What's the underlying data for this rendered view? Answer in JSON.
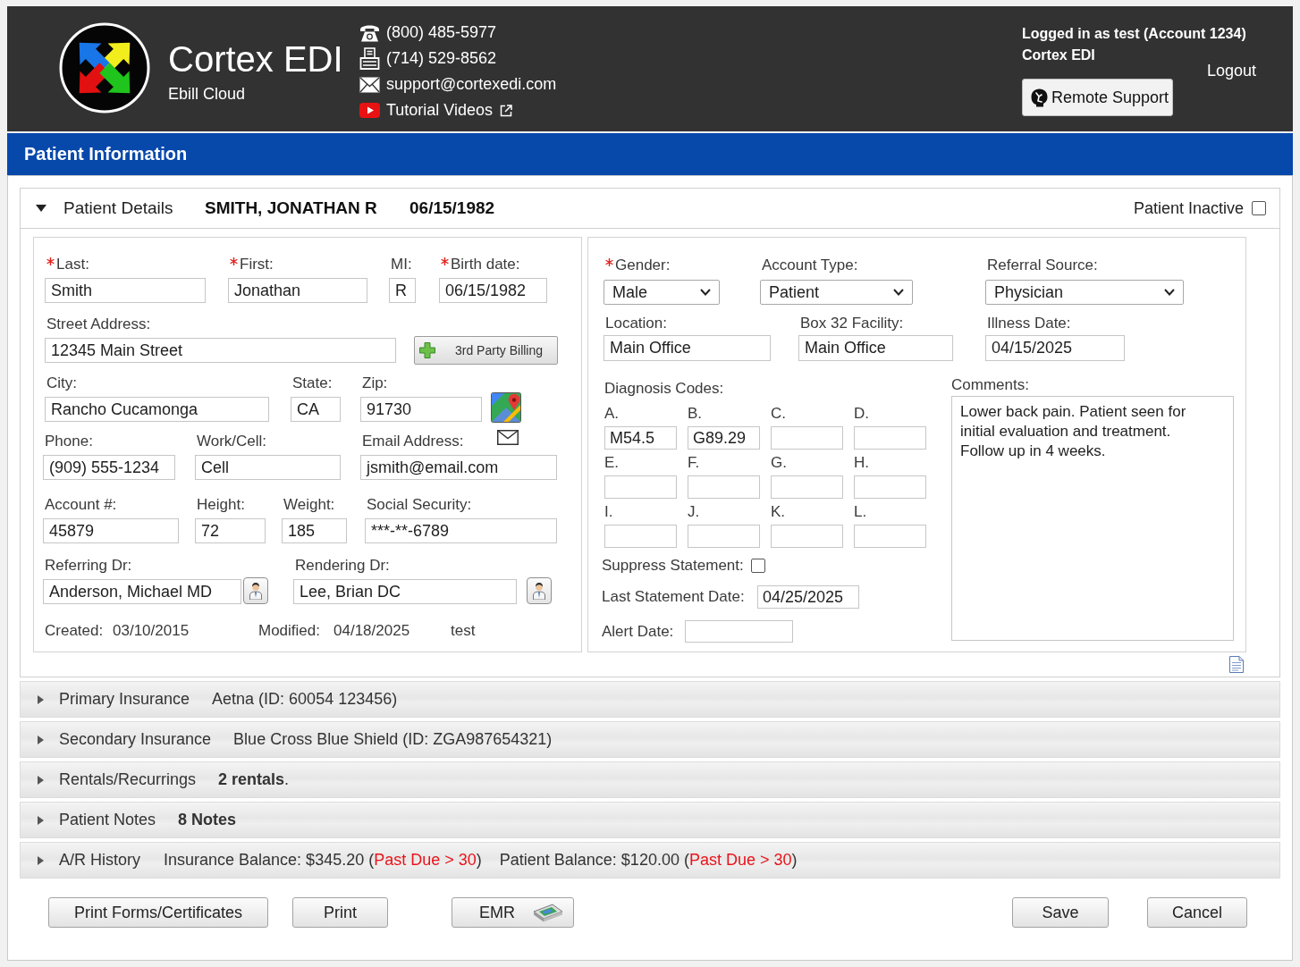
{
  "header": {
    "brand": {
      "title": "Cortex EDI",
      "subtitle": "Ebill Cloud"
    },
    "contacts": [
      {
        "kind": "phone",
        "text": "(800) 485-5977"
      },
      {
        "kind": "fax",
        "text": "(714) 529-8562"
      },
      {
        "kind": "email",
        "text": "support@cortexedi.com"
      },
      {
        "kind": "video",
        "text": "Tutorial Videos"
      }
    ],
    "account": {
      "user": "Logged in as test (Account 1234)",
      "organization": "Cortex EDI"
    },
    "logout": "Logout",
    "remote_support": "Remote Support"
  },
  "page_title": "Patient Information",
  "patient_details": {
    "title": "Patient Details",
    "expanded": true,
    "patient_name": "SMITH, JONATHAN R",
    "birth_date": "06/15/1982",
    "inactive": {
      "label": "Patient Inactive",
      "checked": false
    },
    "demographics": {
      "rows": [
        [
          {
            "kind": "text",
            "label": "Last:",
            "required": true,
            "value": "Smith"
          },
          {
            "kind": "text",
            "label": "First:",
            "required": true,
            "value": "Jonathan"
          },
          {
            "kind": "text",
            "label": "MI:",
            "required": false,
            "value": "R"
          },
          {
            "kind": "text",
            "label": "Birth date:",
            "required": true,
            "value": "06/15/1982"
          }
        ],
        [
          {
            "kind": "text",
            "label": "Street Address:",
            "required": false,
            "value": "12345 Main Street"
          },
          {
            "kind": "button",
            "label": "3rd Party Billing"
          }
        ],
        [
          {
            "kind": "text",
            "label": "City:",
            "required": false,
            "value": "Rancho Cucamonga"
          },
          {
            "kind": "text",
            "label": "State:",
            "required": false,
            "value": "CA"
          },
          {
            "kind": "text",
            "label": "Zip:",
            "required": false,
            "value": "91730"
          },
          {
            "kind": "map"
          }
        ],
        [
          {
            "kind": "text",
            "label": "Phone:",
            "required": false,
            "value": "(909) 555-1234"
          },
          {
            "kind": "text",
            "label": "Work/Cell:",
            "required": false,
            "value": "Cell"
          },
          {
            "kind": "email",
            "label": "Email Address:",
            "required": false,
            "value": "jsmith@email.com"
          }
        ],
        [
          {
            "kind": "text",
            "label": "Account #:",
            "required": false,
            "value": "45879"
          },
          {
            "kind": "text",
            "label": "Height:",
            "required": false,
            "value": "72"
          },
          {
            "kind": "text",
            "label": "Weight:",
            "required": false,
            "value": "185"
          },
          {
            "kind": "text",
            "label": "Social Security:",
            "required": false,
            "value": "***-**-6789"
          }
        ],
        [
          {
            "kind": "text",
            "label": "Referring Dr:",
            "required": false,
            "value": "Anderson, Michael MD"
          },
          {
            "kind": "lookup"
          },
          {
            "kind": "text",
            "label": "Rendering Dr:",
            "required": false,
            "value": "Lee, Brian DC"
          },
          {
            "kind": "lookup"
          }
        ]
      ],
      "created": {
        "label": "Created:",
        "value": "03/10/2015"
      },
      "modified": {
        "label": "Modified:",
        "value": "04/18/2025",
        "user": "test"
      }
    },
    "account": {
      "rows": [
        [
          {
            "kind": "select",
            "label": "Gender:",
            "required": true,
            "value": "Male"
          },
          {
            "kind": "select",
            "label": "Account Type:",
            "required": false,
            "value": "Patient"
          },
          {
            "kind": "select",
            "label": "Referral Source:",
            "required": false,
            "value": "Physician"
          }
        ],
        [
          {
            "kind": "text",
            "label": "Location:",
            "required": false,
            "value": "Main Office"
          },
          {
            "kind": "text",
            "label": "Box 32 Facility:",
            "required": false,
            "value": "Main Office"
          },
          {
            "kind": "text",
            "label": "Illness Date:",
            "required": false,
            "value": "04/15/2025"
          }
        ]
      ],
      "diagnosis_codes": {
        "label": "Diagnosis Codes:",
        "codes": [
          {
            "letter": "A.",
            "value": "M54.5"
          },
          {
            "letter": "B.",
            "value": "G89.29"
          },
          {
            "letter": "C."
          },
          {
            "letter": "D."
          },
          {
            "letter": "E."
          },
          {
            "letter": "F."
          },
          {
            "letter": "G."
          },
          {
            "letter": "H."
          },
          {
            "letter": "I."
          },
          {
            "letter": "J."
          },
          {
            "letter": "K."
          },
          {
            "letter": "L."
          }
        ]
      },
      "suppress_statement": {
        "label": "Suppress Statement:",
        "checked": false
      },
      "last_statement_date": {
        "label": "Last Statement Date:",
        "value": "04/25/2025"
      },
      "alert_date": {
        "label": "Alert Date:"
      },
      "comments": {
        "label": "Comments:",
        "value": "Lower back pain. Patient seen for initial evaluation and treatment. Follow up in 4 weeks."
      }
    }
  },
  "sections": [
    {
      "kind": "text",
      "title": "Primary Insurance",
      "expanded": false,
      "summary": "Aetna (ID: 60054 123456)",
      "bold": false
    },
    {
      "kind": "text",
      "title": "Secondary Insurance",
      "expanded": false,
      "summary": "Blue Cross Blue Shield (ID: ZGA987654321)",
      "bold": false
    },
    {
      "kind": "text",
      "title": "Rentals/Recurrings",
      "expanded": false,
      "summary": "**2 rentals**.",
      "bold": false
    },
    {
      "kind": "text",
      "title": "Patient Notes",
      "expanded": false,
      "summary": "8 Notes",
      "bold": true
    },
    {
      "kind": "balances",
      "title": "A/R History",
      "expanded": false,
      "balances": [
        {
          "segments": [
            {
              "text": "Insurance Balance: $345.20 (",
              "past_due": false
            },
            {
              "text": "Past Due > 30",
              "past_due": true
            },
            {
              "text": ")",
              "past_due": false
            }
          ]
        },
        {
          "segments": [
            {
              "text": "Patient Balance: $120.00 (",
              "past_due": false
            },
            {
              "text": "Past Due > 30",
              "past_due": true
            },
            {
              "text": ")",
              "past_due": false
            }
          ]
        }
      ]
    }
  ],
  "actions": {
    "left": [
      {
        "kind": "plain",
        "label": "Print Forms/Certificates"
      },
      {
        "kind": "plain",
        "label": "Print"
      },
      {
        "kind": "scanner",
        "label": "EMR"
      }
    ],
    "right": [
      {
        "kind": "plain",
        "label": "Save"
      },
      {
        "kind": "plain",
        "label": "Cancel"
      }
    ]
  }
}
